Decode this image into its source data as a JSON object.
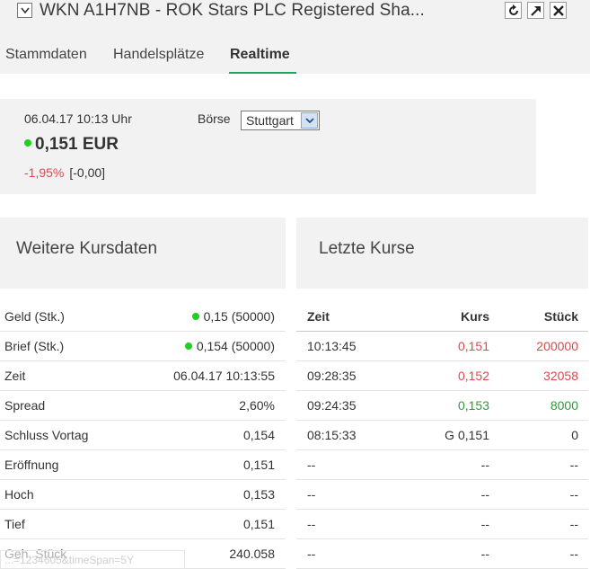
{
  "window": {
    "title": "WKN A1H7NB - ROK Stars PLC Registered Sha..."
  },
  "tabs": [
    {
      "label": "Stammdaten"
    },
    {
      "label": "Handelsplätze"
    },
    {
      "label": "Realtime"
    }
  ],
  "quote": {
    "datetime": "06.04.17  10:13 Uhr",
    "boerse_label": "Börse",
    "boerse_selected": "Stuttgart",
    "price": "0,151 EUR",
    "change_pct": "-1,95%",
    "change_abs": "[-0,00]"
  },
  "left_section": {
    "title": "Weitere Kursdaten",
    "rows": [
      {
        "label": "Geld (Stk.)",
        "value": "0,15 (50000)"
      },
      {
        "label": "Brief (Stk.)",
        "value": "0,154 (50000)"
      },
      {
        "label": "Zeit",
        "value": "06.04.17 10:13:55"
      },
      {
        "label": "Spread",
        "value": "2,60%"
      },
      {
        "label": "Schluss Vortag",
        "value": "0,154"
      },
      {
        "label": "Eröffnung",
        "value": "0,151"
      },
      {
        "label": "Hoch",
        "value": "0,153"
      },
      {
        "label": "Tief",
        "value": "0,151"
      },
      {
        "label": "Geh. Stück",
        "value": "240.058"
      }
    ]
  },
  "right_section": {
    "title": "Letzte Kurse",
    "columns": [
      "Zeit",
      "Kurs",
      "Stück"
    ],
    "rows": [
      {
        "zeit": "10:13:45",
        "kurs": "0,151",
        "stueck": "200000",
        "color": "red"
      },
      {
        "zeit": "09:28:35",
        "kurs": "0,152",
        "stueck": "32058",
        "color": "red"
      },
      {
        "zeit": "09:24:35",
        "kurs": "0,153",
        "stueck": "8000",
        "color": "green"
      },
      {
        "zeit": "08:15:33",
        "kurs": "G 0,151",
        "stueck": "0",
        "color": "dark"
      },
      {
        "zeit": "--",
        "kurs": "--",
        "stueck": "--",
        "color": "dark"
      },
      {
        "zeit": "--",
        "kurs": "--",
        "stueck": "--",
        "color": "dark"
      },
      {
        "zeit": "--",
        "kurs": "--",
        "stueck": "--",
        "color": "dark"
      },
      {
        "zeit": "--",
        "kurs": "--",
        "stueck": "--",
        "color": "dark"
      }
    ]
  },
  "status_url": "...=1234605&timeSpan=5Y",
  "colors": {
    "accent_green": "#1fa463",
    "negative_red": "#e0474c",
    "positive_green": "#2f9a3a",
    "panel_bg": "#f2f2f2"
  },
  "icons": [
    "checkbox-icon",
    "refresh-icon",
    "popout-icon",
    "close-icon",
    "chevron-down-icon",
    "status-dot-icon"
  ]
}
